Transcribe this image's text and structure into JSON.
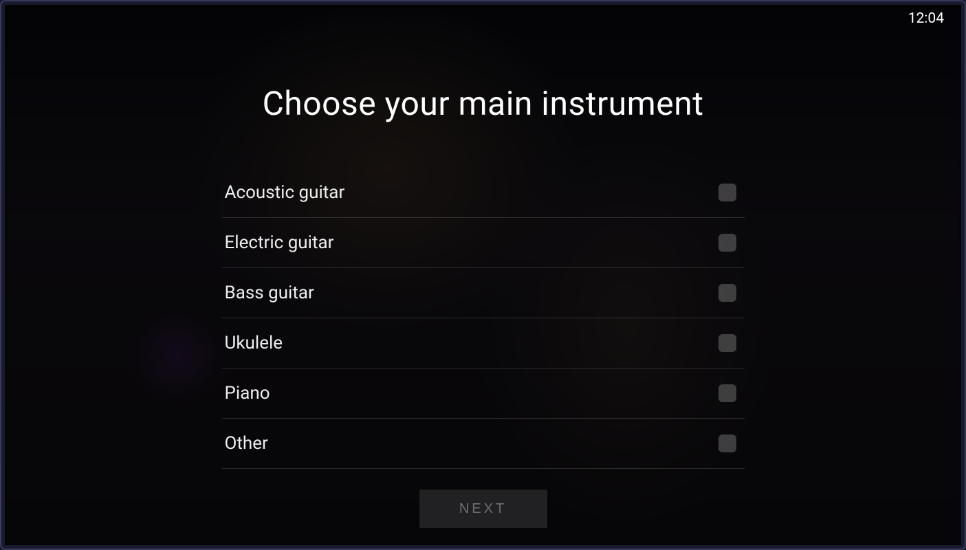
{
  "statusBar": {
    "time": "12:04"
  },
  "title": "Choose your main instrument",
  "options": [
    {
      "label": "Acoustic guitar",
      "checked": false
    },
    {
      "label": "Electric guitar",
      "checked": false
    },
    {
      "label": "Bass guitar",
      "checked": false
    },
    {
      "label": "Ukulele",
      "checked": false
    },
    {
      "label": "Piano",
      "checked": false
    },
    {
      "label": "Other",
      "checked": false
    }
  ],
  "nextButton": {
    "label": "NEXT",
    "enabled": false
  }
}
